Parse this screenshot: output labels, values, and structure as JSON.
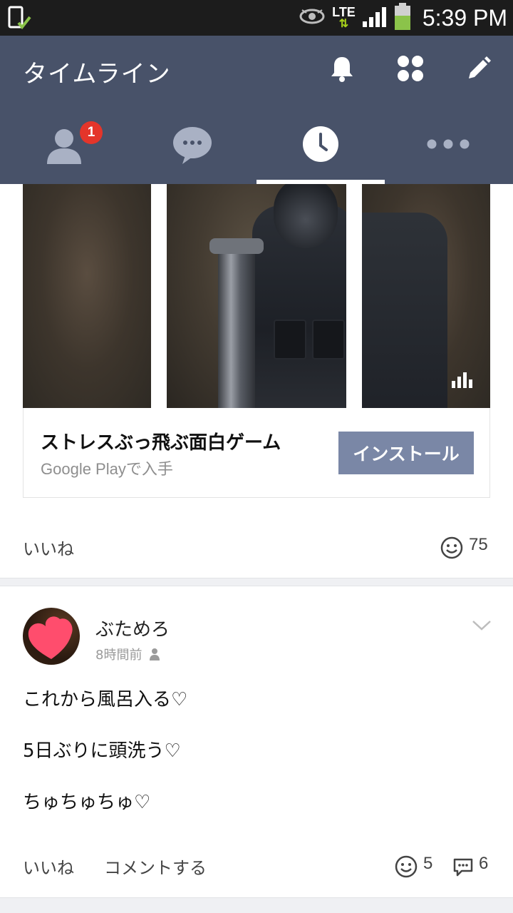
{
  "status_bar": {
    "time": "5:39 PM",
    "network": "LTE",
    "network_arrows": "⇅"
  },
  "header": {
    "title": "タイムライン",
    "tabs": [
      {
        "name": "friends",
        "badge": "1"
      },
      {
        "name": "chats"
      },
      {
        "name": "timeline",
        "active": true
      },
      {
        "name": "more"
      }
    ]
  },
  "ad": {
    "title": "ストレスぶっ飛ぶ面白ゲーム",
    "subtitle": "Google Playで入手",
    "install_label": "インストール",
    "like_label": "いいね",
    "reaction_count": "75"
  },
  "post": {
    "author": "ぶためろ",
    "time": "8時間前",
    "lines": [
      "これから風呂入る♡",
      "5日ぶりに頭洗う♡",
      "ちゅちゅちゅ♡"
    ],
    "like_label": "いいね",
    "comment_label": "コメントする",
    "reaction_count": "5",
    "comment_count": "6"
  },
  "colors": {
    "header_bg": "#485269",
    "install_button": "#7a87a6",
    "badge": "#e4352a",
    "status_bar": "#1c1c1c"
  }
}
